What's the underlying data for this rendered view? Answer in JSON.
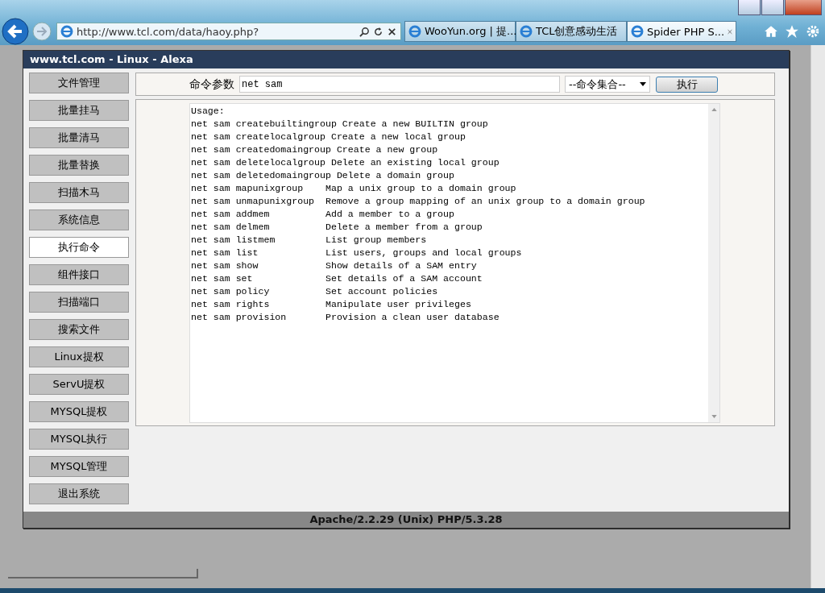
{
  "browser": {
    "address": "http://www.tcl.com/data/haoy.php?",
    "tabs": [
      {
        "label": "WooYun.org | 提...",
        "selected": false
      },
      {
        "label": "TCL创意感动生活",
        "selected": false
      },
      {
        "label": "Spider PHP S...",
        "selected": true
      }
    ]
  },
  "page": {
    "title": "www.tcl.com - Linux - Alexa",
    "sidebar": {
      "items": [
        {
          "label": "文件管理",
          "selected": false
        },
        {
          "label": "批量挂马",
          "selected": false
        },
        {
          "label": "批量清马",
          "selected": false
        },
        {
          "label": "批量替换",
          "selected": false
        },
        {
          "label": "扫描木马",
          "selected": false
        },
        {
          "label": "系统信息",
          "selected": false
        },
        {
          "label": "执行命令",
          "selected": true
        },
        {
          "label": "组件接口",
          "selected": false
        },
        {
          "label": "扫描端口",
          "selected": false
        },
        {
          "label": "搜索文件",
          "selected": false
        },
        {
          "label": "Linux提权",
          "selected": false
        },
        {
          "label": "ServU提权",
          "selected": false
        },
        {
          "label": "MYSQL提权",
          "selected": false
        },
        {
          "label": "MYSQL执行",
          "selected": false
        },
        {
          "label": "MYSQL管理",
          "selected": false
        },
        {
          "label": "退出系统",
          "selected": false
        }
      ]
    },
    "command": {
      "label": "命令参数",
      "value": "net sam",
      "preset": "--命令集合--",
      "button": "执行"
    },
    "output": [
      "Usage:",
      "net sam createbuiltingroup Create a new BUILTIN group",
      "net sam createlocalgroup Create a new local group",
      "net sam createdomaingroup Create a new group",
      "net sam deletelocalgroup Delete an existing local group",
      "net sam deletedomaingroup Delete a domain group",
      "net sam mapunixgroup    Map a unix group to a domain group",
      "net sam unmapunixgroup  Remove a group mapping of an unix group to a domain group",
      "net sam addmem          Add a member to a group",
      "net sam delmem          Delete a member from a group",
      "net sam listmem         List group members",
      "net sam list            List users, groups and local groups",
      "net sam show            Show details of a SAM entry",
      "net sam set             Set details of a SAM account",
      "net sam policy          Set account policies",
      "net sam rights          Manipulate user privileges",
      "net sam provision       Provision a clean user database"
    ],
    "footer": "Apache/2.2.29 (Unix) PHP/5.3.28"
  }
}
